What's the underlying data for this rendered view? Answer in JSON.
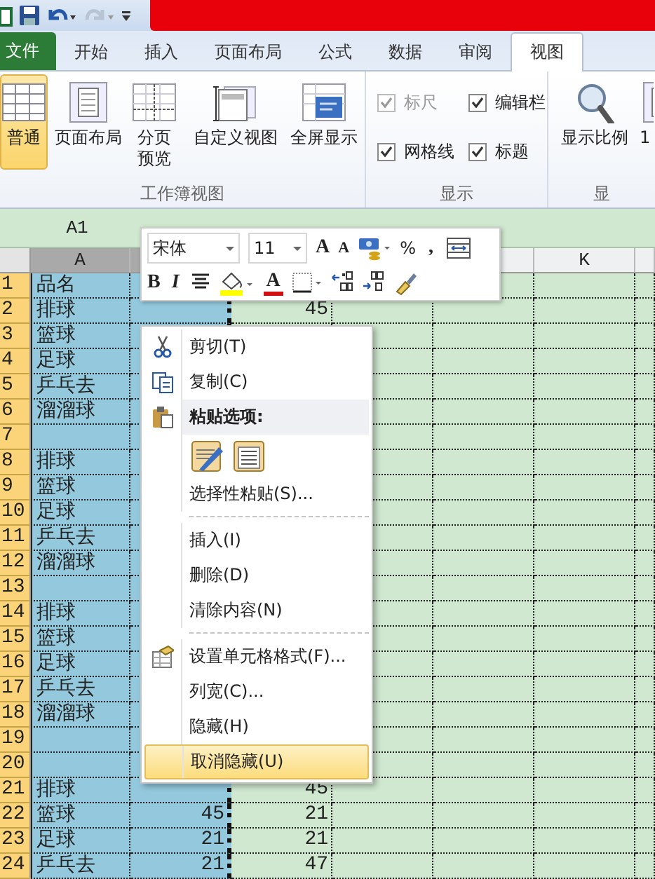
{
  "quick_access": [
    {
      "kind": "app",
      "disabled": false
    },
    {
      "kind": "save",
      "disabled": false
    },
    {
      "kind": "undo",
      "disabled": false
    },
    {
      "kind": "redo",
      "disabled": true
    },
    {
      "kind": "customize",
      "disabled": false
    }
  ],
  "tabs": [
    {
      "label": "文件",
      "kind": "file",
      "selected": false
    },
    {
      "label": "开始",
      "kind": "tab",
      "selected": false
    },
    {
      "label": "插入",
      "kind": "tab",
      "selected": false
    },
    {
      "label": "页面布局",
      "kind": "tab",
      "selected": false
    },
    {
      "label": "公式",
      "kind": "tab",
      "selected": false
    },
    {
      "label": "数据",
      "kind": "tab",
      "selected": false
    },
    {
      "label": "审阅",
      "kind": "tab",
      "selected": false
    },
    {
      "label": "视图",
      "kind": "tab",
      "selected": true
    }
  ],
  "ribbon": {
    "groups": [
      {
        "label": "工作簿视图",
        "kind": "buttons",
        "items": [
          {
            "label": "普通",
            "selected": true
          },
          {
            "label": "页面布局",
            "selected": false
          },
          {
            "label": "分页预览",
            "selected": false
          },
          {
            "label": "自定义视图",
            "selected": false
          },
          {
            "label": "全屏显示",
            "selected": false
          }
        ]
      },
      {
        "label": "显示",
        "kind": "checks",
        "items": [
          {
            "label": "标尺",
            "checked": true,
            "disabled": true
          },
          {
            "label": "编辑栏",
            "checked": true,
            "disabled": false
          },
          {
            "label": "网格线",
            "checked": true,
            "disabled": false
          },
          {
            "label": "标题",
            "checked": true,
            "disabled": false
          }
        ]
      },
      {
        "label": "显",
        "kind": "buttons",
        "items": [
          {
            "label": "显示比例",
            "selected": false
          },
          {
            "label": "1",
            "selected": false
          }
        ]
      }
    ]
  },
  "name_box": "A1",
  "sheet": {
    "columns": [
      {
        "label": "A",
        "selected": true
      },
      {
        "selected": true
      },
      {
        "selected": false
      },
      {
        "selected": false
      },
      {
        "selected": false
      },
      {
        "label": "K",
        "selected": false
      },
      {
        "selected": false
      }
    ],
    "rows": [
      {
        "number": "1",
        "selected": true,
        "a": "品名"
      },
      {
        "number": "2",
        "selected": true,
        "a": "排球",
        "column_3": "45"
      },
      {
        "number": "3",
        "selected": true,
        "a": "篮球"
      },
      {
        "number": "4",
        "selected": true,
        "a": "足球"
      },
      {
        "number": "5",
        "selected": true,
        "a": "乒乓去"
      },
      {
        "number": "6",
        "selected": true,
        "a": "溜溜球"
      },
      {
        "number": "7",
        "selected": true
      },
      {
        "number": "8",
        "selected": true,
        "a": "排球"
      },
      {
        "number": "9",
        "selected": true,
        "a": "篮球"
      },
      {
        "number": "10",
        "selected": true,
        "a": "足球"
      },
      {
        "number": "11",
        "selected": true,
        "a": "乒乓去"
      },
      {
        "number": "12",
        "selected": true,
        "a": "溜溜球"
      },
      {
        "number": "13",
        "selected": true
      },
      {
        "number": "14",
        "selected": true,
        "a": "排球"
      },
      {
        "number": "15",
        "selected": true,
        "a": "篮球"
      },
      {
        "number": "16",
        "selected": true,
        "a": "足球"
      },
      {
        "number": "17",
        "selected": true,
        "a": "乒乓去"
      },
      {
        "number": "18",
        "selected": true,
        "a": "溜溜球"
      },
      {
        "number": "19",
        "selected": true
      },
      {
        "number": "20",
        "selected": true
      },
      {
        "number": "21",
        "selected": true,
        "a": "排球",
        "column_3": "45"
      },
      {
        "number": "22",
        "selected": true,
        "a": "篮球",
        "column_2": "45",
        "column_3": "21"
      },
      {
        "number": "23",
        "selected": true,
        "a": "足球",
        "column_2": "21",
        "column_3": "21"
      },
      {
        "number": "24",
        "selected": true,
        "a": "乒乓去",
        "column_2": "21",
        "column_3": "47"
      }
    ]
  },
  "mini_toolbar": {
    "font": "宋体",
    "size": "11",
    "row_1": [
      {
        "kind": "grow_font",
        "label": "A"
      },
      {
        "kind": "shrink_font",
        "label": "A"
      },
      {
        "kind": "accounting"
      },
      {
        "kind": "percent",
        "label": "%"
      },
      {
        "kind": "comma",
        "label": ","
      },
      {
        "kind": "merge"
      }
    ],
    "row_2": [
      {
        "kind": "bold",
        "label": "B"
      },
      {
        "kind": "italic",
        "label": "I"
      },
      {
        "kind": "center"
      },
      {
        "kind": "fill"
      },
      {
        "kind": "font_color",
        "label": "A"
      },
      {
        "kind": "borders"
      },
      {
        "kind": "inc_decimal"
      },
      {
        "kind": "dec_decimal"
      },
      {
        "kind": "painter"
      }
    ]
  },
  "context_menu": [
    {
      "kind": "item",
      "label": "剪切(T)",
      "selected": false
    },
    {
      "kind": "item",
      "label": "复制(C)",
      "selected": false
    },
    {
      "kind": "header",
      "label": "粘贴选项:"
    },
    {
      "kind": "paste_icons"
    },
    {
      "kind": "item",
      "label": "选择性粘贴(S)...",
      "selected": false
    },
    {
      "kind": "separator"
    },
    {
      "kind": "item",
      "label": "插入(I)",
      "selected": false
    },
    {
      "kind": "item",
      "label": "删除(D)",
      "selected": false
    },
    {
      "kind": "item",
      "label": "清除内容(N)",
      "selected": false
    },
    {
      "kind": "separator"
    },
    {
      "kind": "item",
      "label": "设置单元格格式(F)...",
      "selected": false
    },
    {
      "kind": "item",
      "label": "列宽(C)...",
      "selected": false
    },
    {
      "kind": "item",
      "label": "隐藏(H)",
      "selected": false
    },
    {
      "kind": "item",
      "label": "取消隐藏(U)",
      "selected": true
    }
  ]
}
